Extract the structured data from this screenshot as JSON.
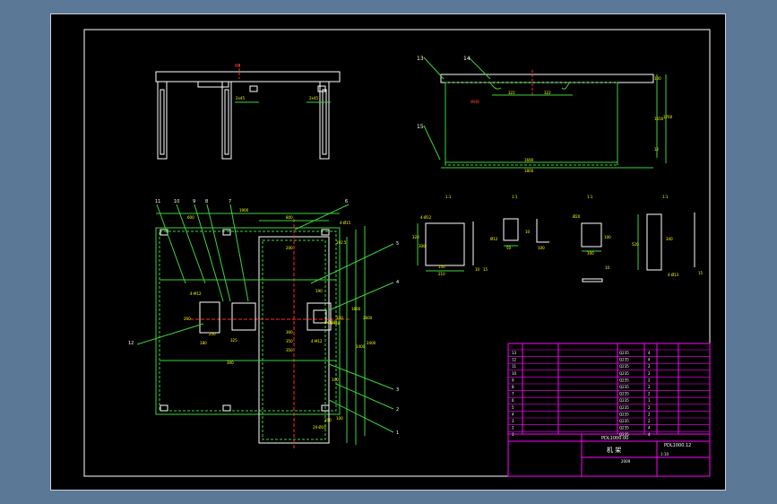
{
  "colors": {
    "background": "#5b7896",
    "paper": "#000000",
    "line": "#ffffff",
    "green": "#00ff00",
    "dim_green": "#3bd43b",
    "red": "#ff2a2a",
    "yellow": "#ffff00",
    "magenta": "#ff00ff"
  },
  "front_view": {
    "title_dim": "60",
    "dims": [
      "2x45",
      "2x45"
    ]
  },
  "side_view": {
    "balloons": [
      "13",
      "14",
      "15"
    ],
    "dims": [
      "322",
      "322",
      "1690",
      "1800",
      "100",
      "1650",
      "1760",
      "12"
    ],
    "weld_label": "Ø8焊"
  },
  "plan_view": {
    "balloons_left": [
      "11",
      "10",
      "9",
      "8",
      "7",
      "12"
    ],
    "balloons_right": [
      "6",
      "5",
      "4",
      "3",
      "2",
      "1"
    ],
    "dims": [
      "1900",
      "800",
      "600",
      "4-Ø15",
      "192.5",
      "190",
      "200",
      "300",
      "350",
      "350",
      "4-M12",
      "325",
      "250",
      "300",
      "260",
      "180",
      "100",
      "200",
      "330",
      "4-M12",
      "4-M8",
      "100",
      "1600",
      "2600",
      "1400",
      "2400",
      "2x150",
      "2X-Ø10"
    ]
  },
  "details": [
    {
      "title": "1:1",
      "dims": [
        "4-Ø12",
        "320",
        "300",
        "150",
        "210",
        "10",
        "15"
      ]
    },
    {
      "title": "1:1",
      "dims": [
        "Ø12",
        "50",
        "100",
        "10"
      ]
    },
    {
      "title": "1:1",
      "dims": [
        "Ø20",
        "100",
        "100",
        "10"
      ]
    },
    {
      "title": "1:1",
      "dims": [
        "520",
        "340",
        "4-Ø13",
        "15"
      ]
    }
  ],
  "title_block": {
    "part_rows": [
      {
        "no": "13",
        "name": "Q235",
        "qty": "4"
      },
      {
        "no": "12",
        "name": "Q235",
        "qty": "4"
      },
      {
        "no": "11",
        "name": "Q235",
        "qty": "2"
      },
      {
        "no": "10",
        "name": "Q235",
        "qty": "2"
      },
      {
        "no": "9",
        "name": "Q235",
        "qty": "2"
      },
      {
        "no": "8",
        "name": "Q235",
        "qty": "2"
      },
      {
        "no": "7",
        "name": "Q235",
        "qty": "2"
      },
      {
        "no": "6",
        "name": "Q235",
        "qty": "1"
      },
      {
        "no": "5",
        "name": "Q235",
        "qty": "2"
      },
      {
        "no": "4",
        "name": "Q235",
        "qty": "2"
      },
      {
        "no": "3",
        "name": "Q235",
        "qty": "2"
      },
      {
        "no": "2",
        "name": "Q235",
        "qty": "4"
      },
      {
        "no": "1",
        "name": "Q235",
        "qty": "4"
      }
    ],
    "drawing_code_left": "PDL1000.00",
    "drawing_code_right": "PDL1000.12",
    "part_title": "机  架",
    "scale": "1:10",
    "date": "2009"
  }
}
